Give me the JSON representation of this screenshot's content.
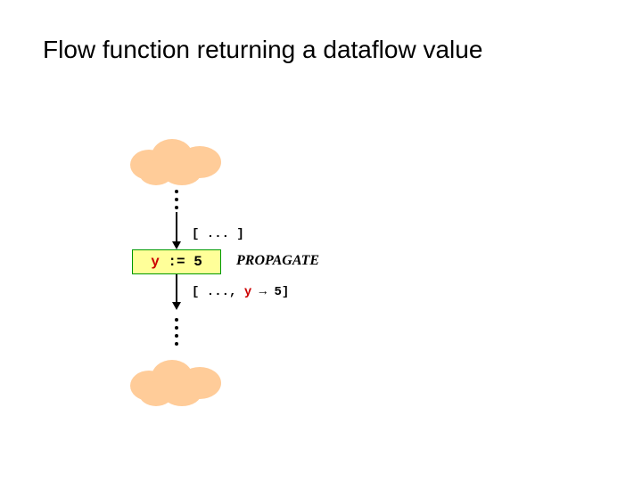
{
  "title": "Flow function returning a dataflow value",
  "input_state": "[ ... ]",
  "statement": {
    "var": "y",
    "rest": " := 5"
  },
  "action": "PROPAGATE",
  "output_state": {
    "prefix": "[ ..., ",
    "var": "y",
    "arrow": " → ",
    "value": "5",
    "suffix": "]"
  }
}
